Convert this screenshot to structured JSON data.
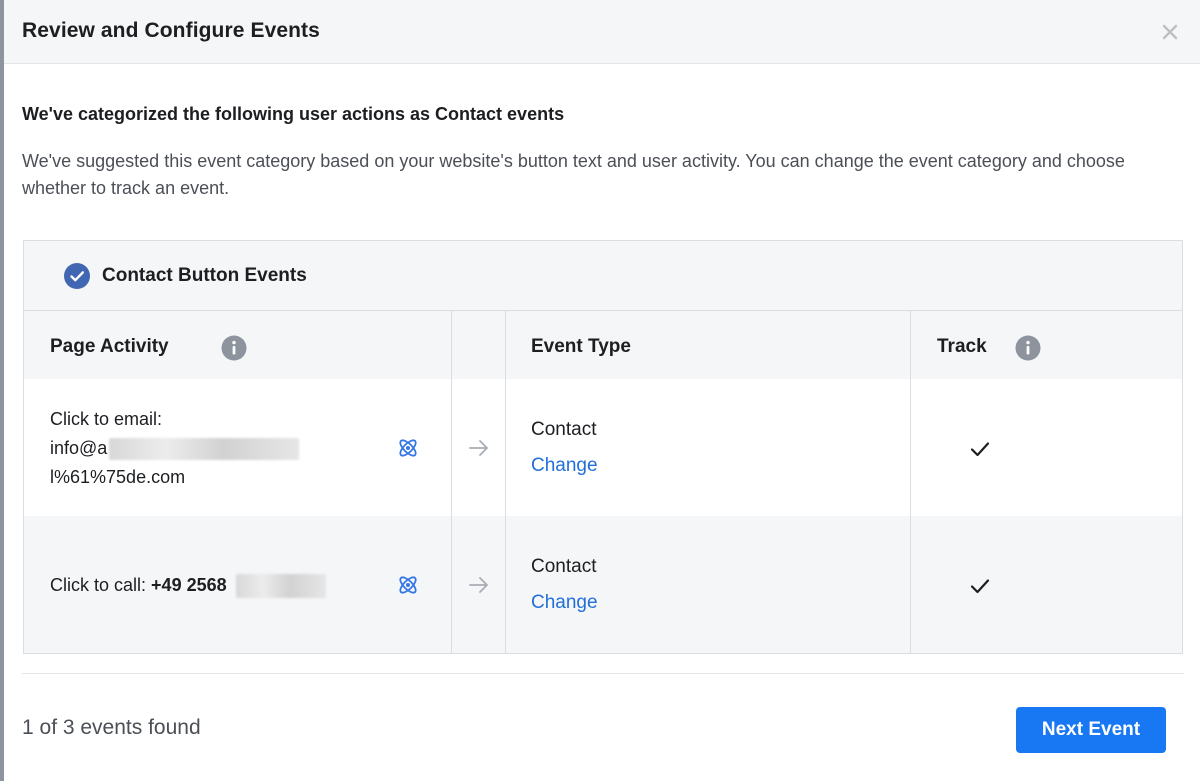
{
  "dialog": {
    "title": "Review and Configure Events",
    "close_icon": "close-icon"
  },
  "intro": {
    "heading": "We've categorized the following user actions as Contact events",
    "description": "We've suggested this event category based on your website's button text and user activity. You can change the event category and choose whether to track an event."
  },
  "group": {
    "title": "Contact Button Events",
    "icon": "check-circle-icon",
    "accent": "#4267b2"
  },
  "table": {
    "headers": {
      "page_activity": "Page Activity",
      "event_type": "Event Type",
      "track": "Track"
    },
    "rows": [
      {
        "activity_label": "Click to email:",
        "activity_value_start": "info@a",
        "activity_value_end": "l%61%75de.com",
        "event_type": "Contact",
        "change_label": "Change",
        "tracked": true
      },
      {
        "activity_label": "Click to call:",
        "activity_value_start": "+49 2568",
        "event_type": "Contact",
        "change_label": "Change",
        "tracked": true
      }
    ]
  },
  "footer": {
    "status": "1 of 3 events found",
    "next_button": "Next Event"
  },
  "colors": {
    "primary": "#1877f2",
    "link": "#216fdb",
    "header_bg": "#f5f6f7",
    "border": "#dadde1"
  }
}
